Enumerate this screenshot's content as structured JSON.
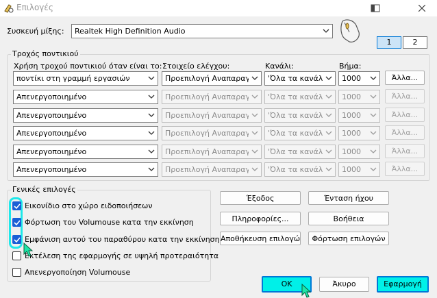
{
  "window": {
    "title": "Επιλογές"
  },
  "device": {
    "label": "Συσκευή μίξης:",
    "value": "Realtek High Definition Audio"
  },
  "page_tabs": [
    "1",
    "2"
  ],
  "wheel": {
    "group_title": "Τροχός ποντικιού",
    "headers": {
      "use": "Χρήση τροχού ποντικιού όταν είναι το:",
      "control": "Στοιχείο ελέγχου:",
      "channel": "Κανάλι:",
      "step": "Βήμα:"
    },
    "rows": [
      {
        "use": "ποντίκι στη γραμμή εργασιών",
        "control": "Προεπιλογή Αναπαραγωγ",
        "channel": "'Όλα τα κανάλια",
        "step": "1000",
        "button": "Άλλα...",
        "enabled": true
      },
      {
        "use": "Απενεργοποιημένο",
        "control": "Προεπιλογή Αναπαραγωγ",
        "channel": "'Όλα τα κανάλια",
        "step": "1000",
        "button": "Άλλα...",
        "enabled": false
      },
      {
        "use": "Απενεργοποιημένο",
        "control": "Προεπιλογή Αναπαραγωγ",
        "channel": "'Όλα τα κανάλια",
        "step": "1000",
        "button": "Άλλα...",
        "enabled": false
      },
      {
        "use": "Απενεργοποιημένο",
        "control": "Προεπιλογή Αναπαραγωγ",
        "channel": "'Όλα τα κανάλια",
        "step": "1000",
        "button": "Άλλα...",
        "enabled": false
      },
      {
        "use": "Απενεργοποιημένο",
        "control": "Προεπιλογή Αναπαραγωγ",
        "channel": "'Όλα τα κανάλια",
        "step": "1000",
        "button": "Άλλα...",
        "enabled": false
      },
      {
        "use": "Απενεργοποιημένο",
        "control": "Προεπιλογή Αναπαραγωγ",
        "channel": "'Όλα τα κανάλια",
        "step": "1000",
        "button": "Άλλα...",
        "enabled": false
      }
    ]
  },
  "general": {
    "group_title": "Γενικές επιλογές",
    "options": [
      {
        "label": "Εικονίδιο στο χώρο ειδοποιήσεων",
        "checked": true
      },
      {
        "label": "Φόρτωση του Volumouse κατα την εκκίνηση",
        "checked": true
      },
      {
        "label": "Εμφάνιση αυτού του παραθύρου κατα την εκκίνηση",
        "checked": true
      },
      {
        "label": "Εκτέλεση της εφαρμογής σε υψηλή προτεραιότητα",
        "checked": false
      },
      {
        "label": "Απενεργοποίηση Volumouse",
        "checked": false
      }
    ],
    "buttons": {
      "exit": "Έξοδος",
      "volume": "Ένταση ήχου",
      "info": "Πληροφορίες...",
      "help": "Βοήθεια",
      "save": "Αποθήκευση επιλογών",
      "load": "Φόρτωση επιλογών"
    }
  },
  "footer": {
    "ok": "OK",
    "cancel": "Άκυρο",
    "apply": "Εφαρμογή"
  },
  "colors": {
    "highlight": "#1ee8ea",
    "accent": "#0078d7",
    "checkbox": "#1a5fd6",
    "ok_fill": "#00f0e8"
  }
}
